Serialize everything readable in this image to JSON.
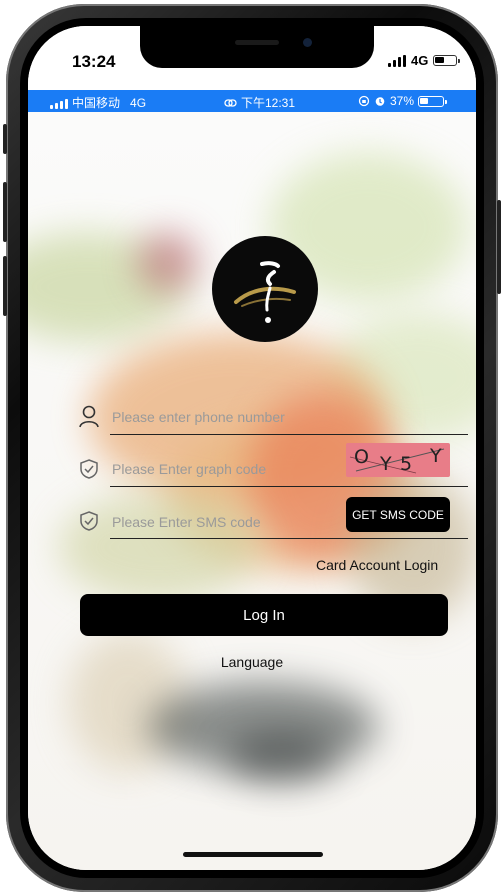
{
  "device_status": {
    "time": "13:24",
    "network": "4G"
  },
  "app_status": {
    "carrier": "中国移动",
    "network": "4G",
    "time": "下午12:31",
    "battery": "37%",
    "battery_level": 0.37,
    "color": "#1a7cf5"
  },
  "login_form": {
    "phone_placeholder": "Please enter phone number",
    "graph_code_placeholder": "Please Enter graph code",
    "captcha_chars": [
      "O",
      "Y",
      "5",
      "Y"
    ],
    "sms_code_placeholder": "Please Enter SMS code",
    "get_sms_code_label": "GET SMS CODE",
    "card_account_login_label": "Card Account Login",
    "login_button_label": "Log In",
    "language_label": "Language"
  },
  "icons": [
    "person-icon",
    "shield-check-icon",
    "shield-check-icon",
    "signal-icon",
    "battery-icon",
    "alarm-icon",
    "link-icon"
  ]
}
